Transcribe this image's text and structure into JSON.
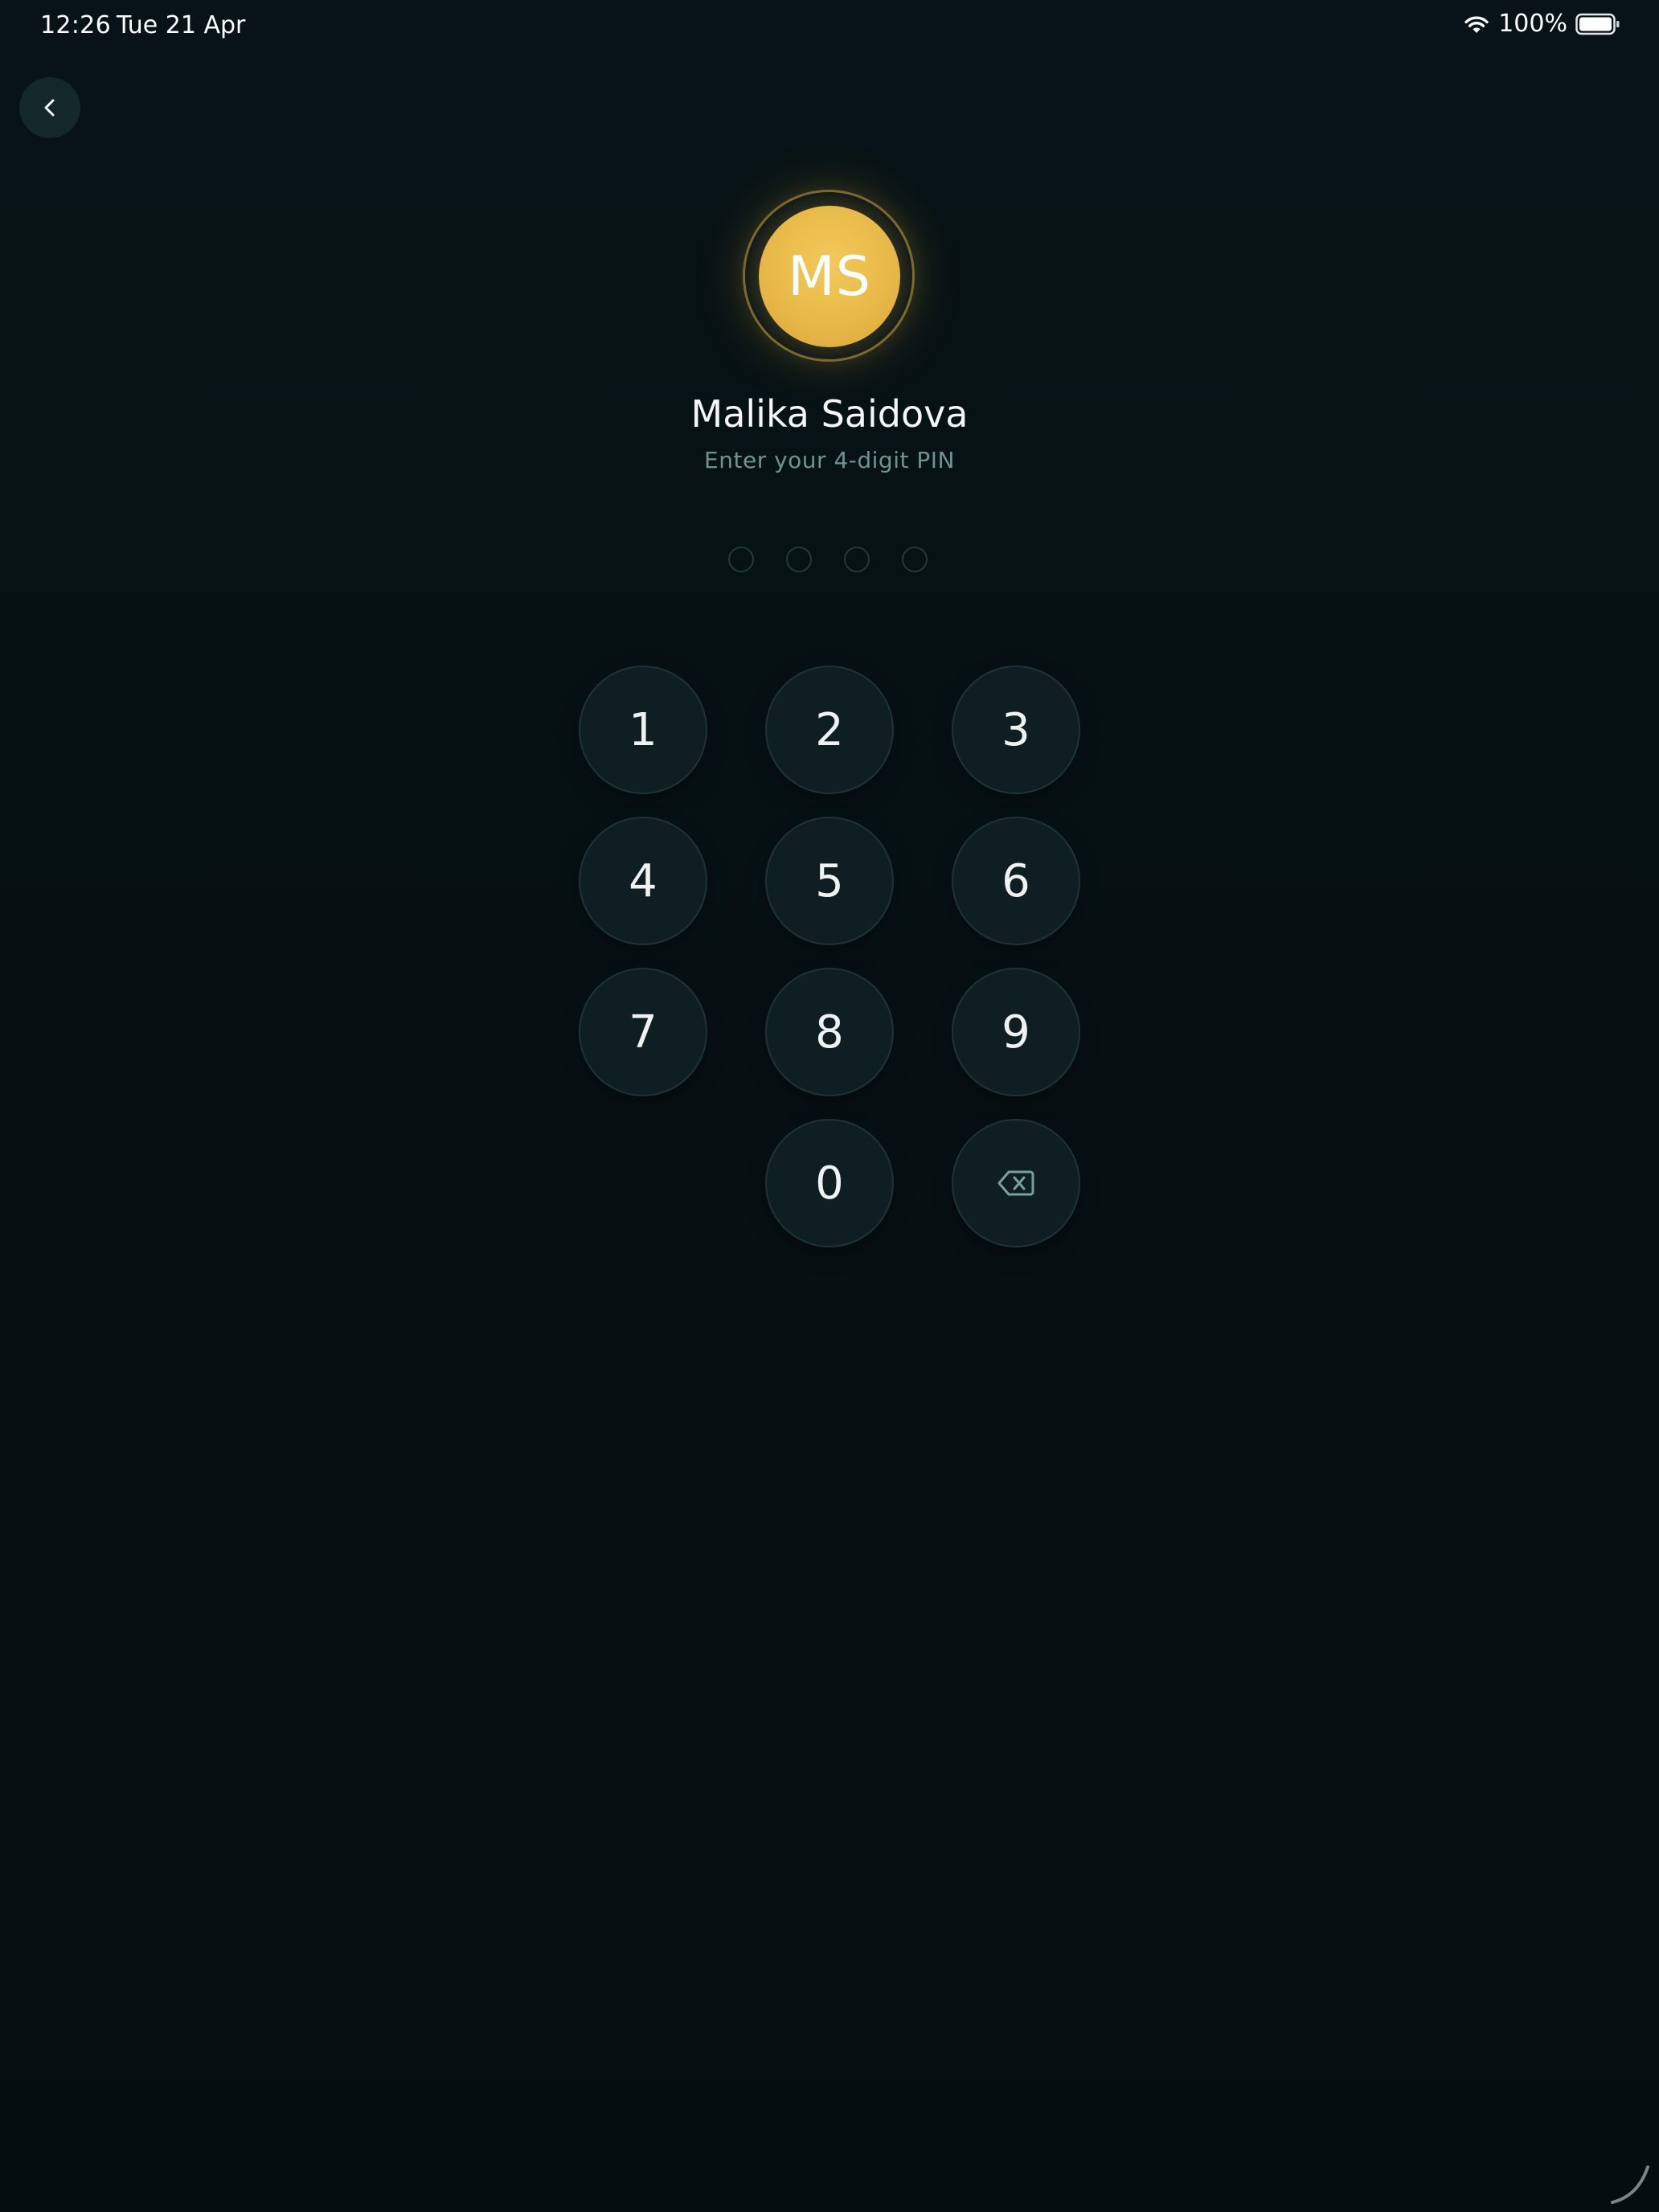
{
  "status_bar": {
    "time": "12:26",
    "date": "Tue 21 Apr",
    "battery": "100%"
  },
  "user": {
    "initials": "MS",
    "name": "Malika Saidova",
    "prompt": "Enter your 4-digit PIN"
  },
  "pin": {
    "length": 4,
    "entered": 0
  },
  "keypad": {
    "k1": "1",
    "k2": "2",
    "k3": "3",
    "k4": "4",
    "k5": "5",
    "k6": "6",
    "k7": "7",
    "k8": "8",
    "k9": "9",
    "k0": "0"
  },
  "colors": {
    "background": "#061012",
    "avatar": "#e8b948",
    "key_background": "#0f1f21",
    "muted_text": "#6f9490"
  }
}
